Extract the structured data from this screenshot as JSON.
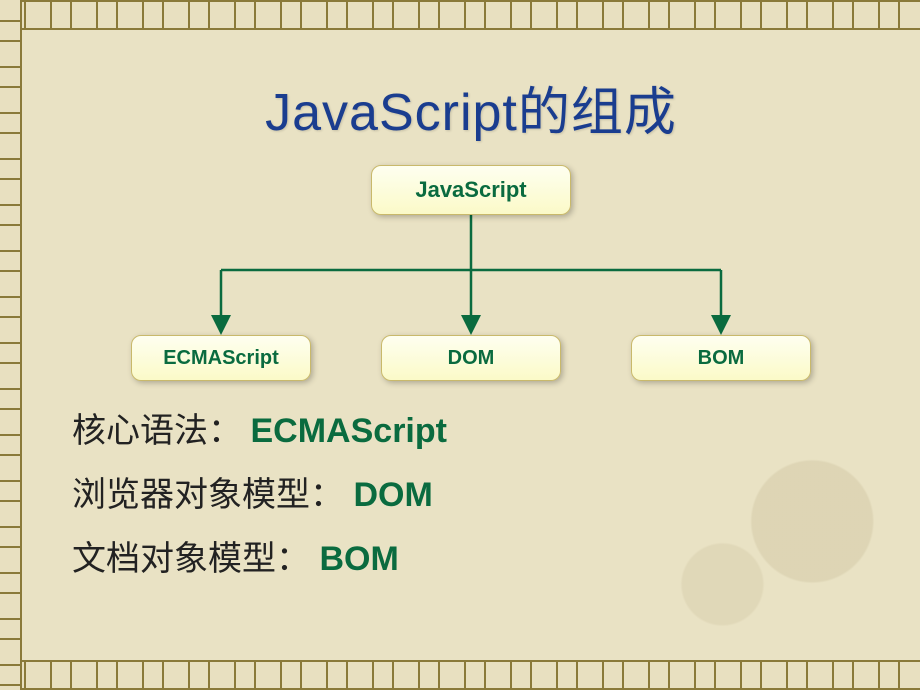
{
  "title": "JavaScript的组成",
  "diagram": {
    "root": "JavaScript",
    "children": [
      "ECMAScript",
      "DOM",
      "BOM"
    ]
  },
  "bullets": [
    {
      "label": "核心语法： ",
      "value": "ECMAScript"
    },
    {
      "label": "浏览器对象模型：",
      "value": "DOM"
    },
    {
      "label": "文档对象模型：",
      "value": "BOM"
    }
  ],
  "chart_data": {
    "type": "diagram",
    "title": "JavaScript的组成",
    "structure": "tree",
    "root": "JavaScript",
    "children": [
      "ECMAScript",
      "DOM",
      "BOM"
    ],
    "annotations": [
      "核心语法： ECMAScript",
      "浏览器对象模型：DOM",
      "文档对象模型：BOM"
    ]
  }
}
